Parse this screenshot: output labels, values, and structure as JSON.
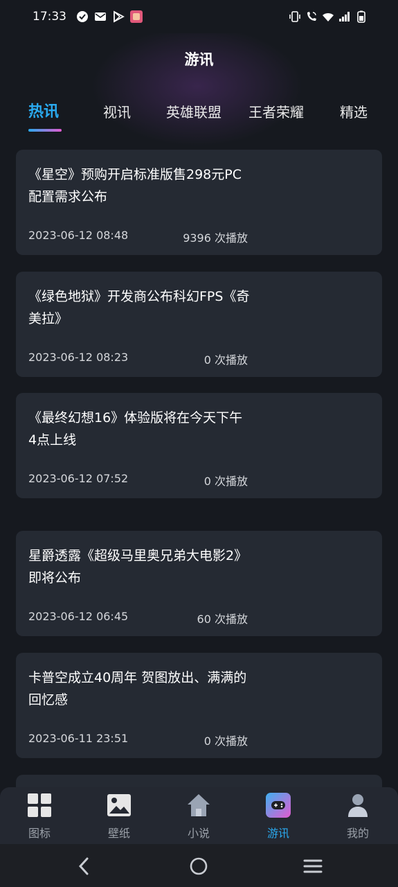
{
  "status_bar": {
    "time": "17:33",
    "left_icons": [
      "check-circle-icon",
      "mail-icon",
      "play-store-icon",
      "app-badge-icon"
    ],
    "right_icons": [
      "vibrate-icon",
      "wifi-call-icon",
      "wifi-icon",
      "signal-icon",
      "battery-icon"
    ]
  },
  "header": {
    "title": "游讯"
  },
  "tabs": [
    {
      "label": "热讯",
      "active": true
    },
    {
      "label": "视讯"
    },
    {
      "label": "英雄联盟"
    },
    {
      "label": "王者荣耀"
    },
    {
      "label": "精选"
    }
  ],
  "articles": [
    {
      "title": "《星空》预购开启标准版售298元PC配置需求公布",
      "date": "2023-06-12 08:48",
      "plays": "9396 次播放"
    },
    {
      "title": "《绿色地狱》开发商公布科幻FPS《奇美拉》",
      "date": "2023-06-12 08:23",
      "plays": "0 次播放"
    },
    {
      "title": "《最终幻想16》体验版将在今天下午4点上线",
      "date": "2023-06-12 07:52",
      "plays": "0 次播放"
    },
    {
      "title": "星爵透露《超级马里奥兄弟大电影2》即将公布",
      "date": "2023-06-12 06:45",
      "plays": "60 次播放"
    },
    {
      "title": "卡普空成立40周年 贺图放出、满满的回忆感",
      "date": "2023-06-11 23:51",
      "plays": "0 次播放"
    }
  ],
  "bottom_nav": [
    {
      "label": "图标",
      "icon": "grid-icon"
    },
    {
      "label": "壁纸",
      "icon": "image-icon"
    },
    {
      "label": "小说",
      "icon": "home-icon"
    },
    {
      "label": "游讯",
      "icon": "gamepad-icon",
      "active": true
    },
    {
      "label": "我的",
      "icon": "user-icon"
    }
  ],
  "colors": {
    "background": "#16191f",
    "card": "#252a33",
    "accent": "#2aa9ee",
    "accent_gradient_end": "#e25bd0",
    "muted_text": "#9aa0a8"
  }
}
